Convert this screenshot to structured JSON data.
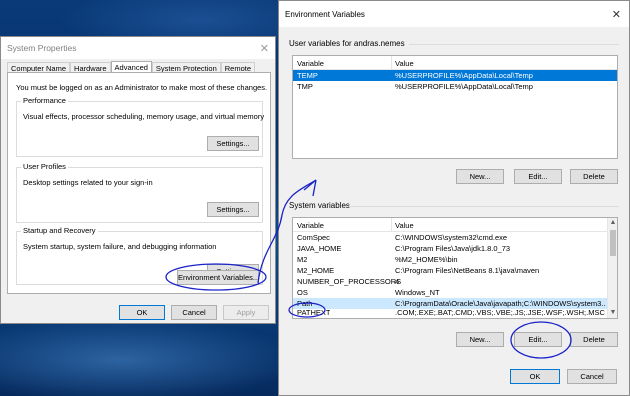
{
  "system_properties": {
    "title": "System Properties",
    "tabs": [
      "Computer Name",
      "Hardware",
      "Advanced",
      "System Protection",
      "Remote"
    ],
    "admin_note": "You must be logged on as an Administrator to make most of these changes.",
    "performance": {
      "legend": "Performance",
      "desc": "Visual effects, processor scheduling, memory usage, and virtual memory",
      "button": "Settings..."
    },
    "user_profiles": {
      "legend": "User Profiles",
      "desc": "Desktop settings related to your sign-in",
      "button": "Settings..."
    },
    "startup": {
      "legend": "Startup and Recovery",
      "desc": "System startup, system failure, and debugging information",
      "button": "Settings..."
    },
    "env_button": "Environment Variables...",
    "ok": "OK",
    "cancel": "Cancel",
    "apply": "Apply"
  },
  "environment_variables": {
    "title": "Environment Variables",
    "user_label": "User variables for andras.nemes",
    "user_columns": [
      "Variable",
      "Value"
    ],
    "user_rows": [
      {
        "variable": "TEMP",
        "value": "%USERPROFILE%\\AppData\\Local\\Temp"
      },
      {
        "variable": "TMP",
        "value": "%USERPROFILE%\\AppData\\Local\\Temp"
      }
    ],
    "user_buttons": {
      "new": "New...",
      "edit": "Edit...",
      "delete": "Delete"
    },
    "system_label": "System variables",
    "system_columns": [
      "Variable",
      "Value"
    ],
    "system_rows": [
      {
        "variable": "ComSpec",
        "value": "C:\\WINDOWS\\system32\\cmd.exe"
      },
      {
        "variable": "JAVA_HOME",
        "value": "C:\\Program Files\\Java\\jdk1.8.0_73"
      },
      {
        "variable": "M2",
        "value": "%M2_HOME%\\bin"
      },
      {
        "variable": "M2_HOME",
        "value": "C:\\Program Files\\NetBeans 8.1\\java\\maven"
      },
      {
        "variable": "NUMBER_OF_PROCESSORS",
        "value": "4"
      },
      {
        "variable": "OS",
        "value": "Windows_NT"
      },
      {
        "variable": "Path",
        "value": "C:\\ProgramData\\Oracle\\Java\\javapath;C:\\WINDOWS\\system3..."
      },
      {
        "variable": "PATHEXT",
        "value": ".COM;.EXE;.BAT;.CMD;.VBS;.VBE;.JS;.JSE;.WSF;.WSH;.MSC"
      }
    ],
    "system_buttons": {
      "new": "New...",
      "edit": "Edit...",
      "delete": "Delete"
    },
    "ok": "OK",
    "cancel": "Cancel"
  },
  "colors": {
    "accent": "#0078d7",
    "annotation_ink": "#1a22c8"
  }
}
